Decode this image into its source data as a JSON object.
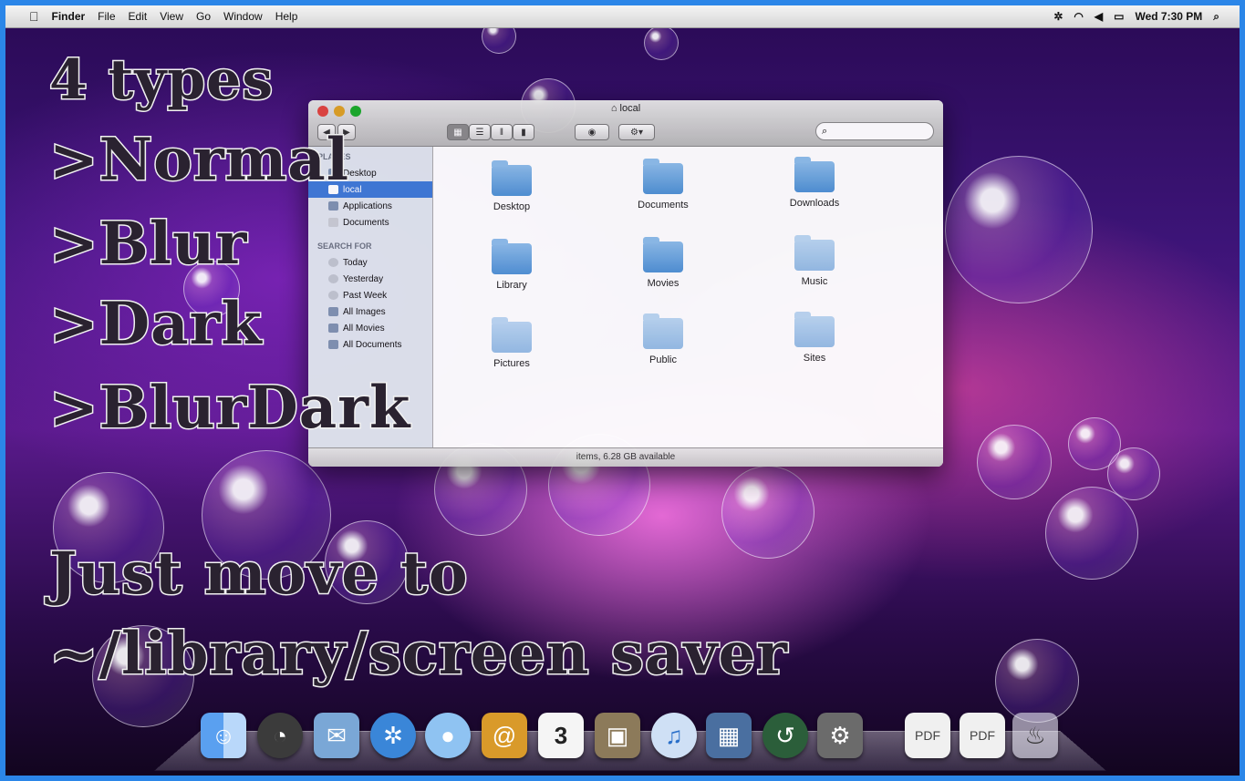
{
  "menubar": {
    "apple": "",
    "items": [
      "Finder",
      "File",
      "Edit",
      "View",
      "Go",
      "Window",
      "Help"
    ],
    "clock": "Wed 7:30 PM",
    "status_icons": [
      "bluetooth-icon",
      "wifi-icon",
      "volume-icon",
      "battery-icon",
      "spotlight-icon"
    ]
  },
  "overlay": {
    "line1": "4 types",
    "line2": ">Normal",
    "line3": ">Blur",
    "line4": ">Dark",
    "line5": ">BlurDark",
    "line6": "Just move to",
    "line7": "~/library/screen saver"
  },
  "finder": {
    "title": "local",
    "search_placeholder": "",
    "sidebar": {
      "places_header": "PLACES",
      "places": [
        "Desktop",
        "local",
        "Applications",
        "Documents"
      ],
      "search_header": "SEARCH FOR",
      "searches": [
        "Today",
        "Yesterday",
        "Past Week",
        "All Images",
        "All Movies",
        "All Documents"
      ]
    },
    "folders": [
      "Desktop",
      "Documents",
      "Downloads",
      "Library",
      "Movies",
      "Music",
      "Pictures",
      "Public",
      "Sites"
    ],
    "status": "items, 6.28 GB available"
  },
  "dock": {
    "calendar_day": "3",
    "icons": [
      "finder-icon",
      "dashboard-icon",
      "mail-icon",
      "safari-icon",
      "ichat-icon",
      "address-book-icon",
      "ical-icon",
      "photo-icon",
      "itunes-icon",
      "spaces-icon",
      "time-machine-icon",
      "system-preferences-icon",
      "pdf-doc-icon",
      "pdf-doc-icon",
      "trash-icon"
    ]
  },
  "colors": {
    "frame": "#2b86e8",
    "selection": "#3e7ad6",
    "text_fill": "#2a2230",
    "text_outline": "#f2f2f2"
  }
}
